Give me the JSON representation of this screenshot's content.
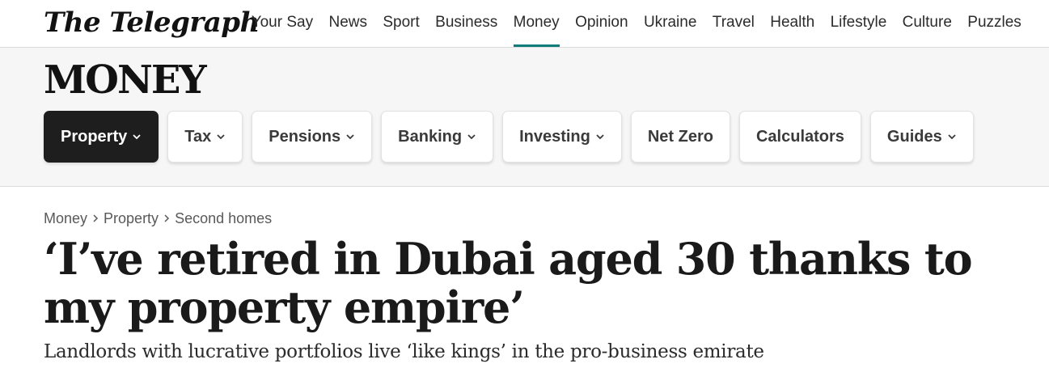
{
  "masthead": {
    "logo_text": "The Telegraph"
  },
  "nav": {
    "items": [
      {
        "label": "Your Say"
      },
      {
        "label": "News"
      },
      {
        "label": "Sport"
      },
      {
        "label": "Business"
      },
      {
        "label": "Money",
        "active": true
      },
      {
        "label": "Opinion"
      },
      {
        "label": "Ukraine"
      },
      {
        "label": "Travel"
      },
      {
        "label": "Health"
      },
      {
        "label": "Lifestyle"
      },
      {
        "label": "Culture"
      },
      {
        "label": "Puzzles"
      }
    ]
  },
  "section": {
    "title": "MONEY",
    "pills": [
      {
        "label": "Property",
        "dropdown": true,
        "active": true
      },
      {
        "label": "Tax",
        "dropdown": true
      },
      {
        "label": "Pensions",
        "dropdown": true
      },
      {
        "label": "Banking",
        "dropdown": true
      },
      {
        "label": "Investing",
        "dropdown": true
      },
      {
        "label": "Net Zero",
        "dropdown": false
      },
      {
        "label": "Calculators",
        "dropdown": false
      },
      {
        "label": "Guides",
        "dropdown": true
      }
    ]
  },
  "breadcrumb": {
    "items": [
      "Money",
      "Property",
      "Second homes"
    ],
    "separator_icon": "chevron-right-icon"
  },
  "article": {
    "headline": "‘I’ve retired in Dubai aged 30 thanks to my property empire’",
    "standfirst": "Landlords with lucrative portfolios live ‘like kings’ in the pro-business emirate"
  },
  "colors": {
    "accent": "#0f7d7a",
    "active_pill_bg": "#1e1e1e",
    "band_bg": "#f6f6f6"
  }
}
